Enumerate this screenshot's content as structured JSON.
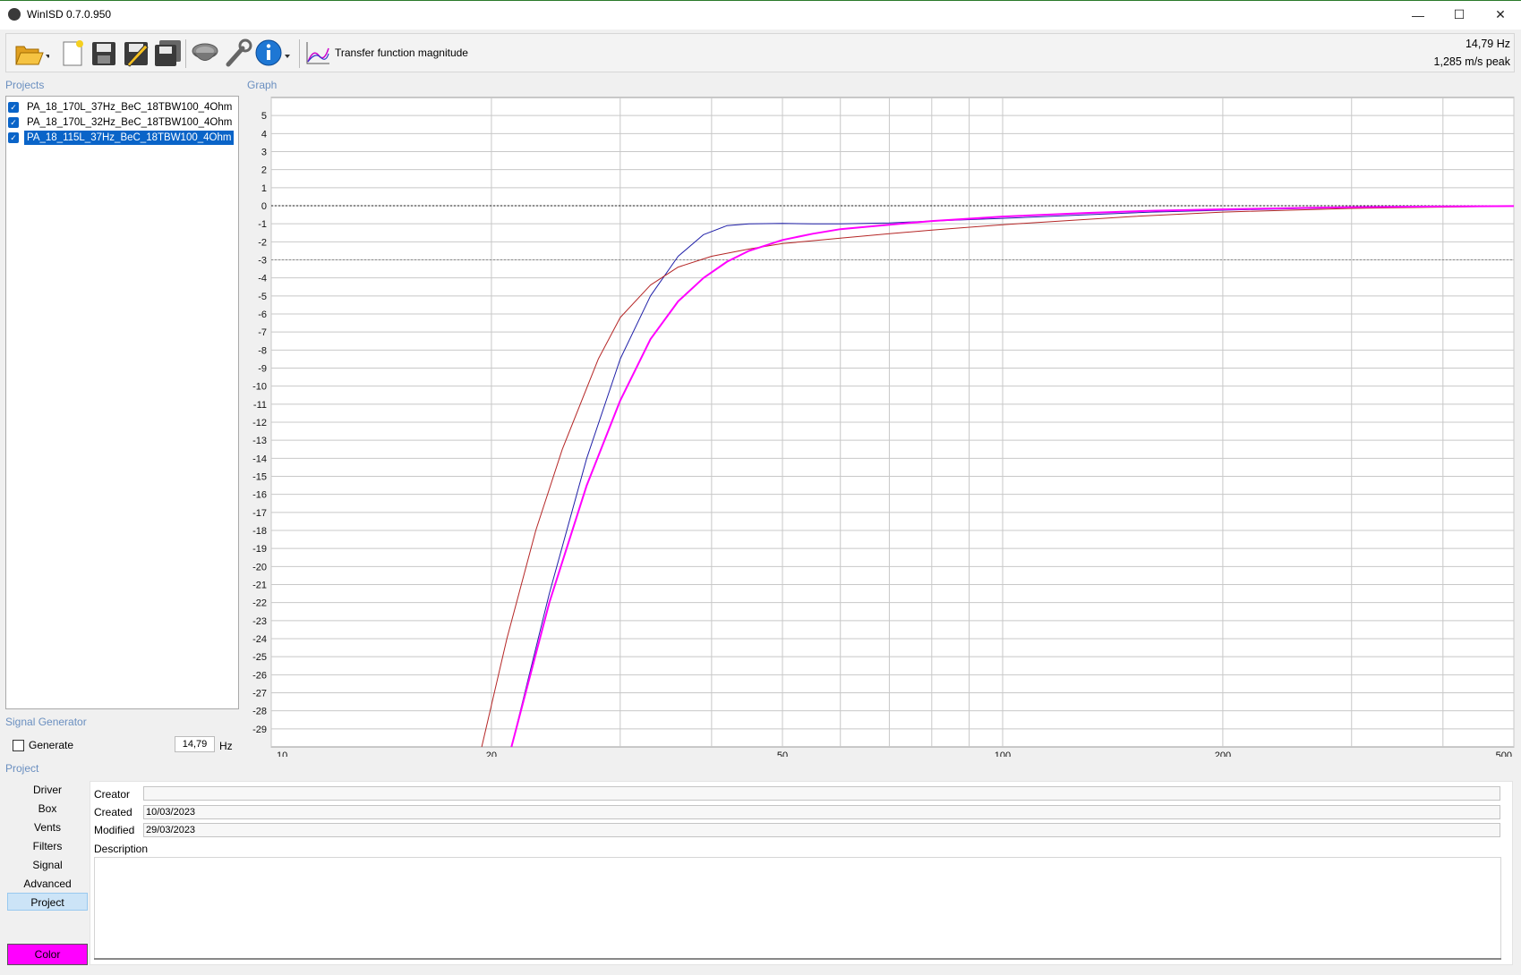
{
  "window": {
    "title": "WinISD 0.7.0.950",
    "minimize": "—",
    "maximize": "☐",
    "close": "✕"
  },
  "toolbar": {
    "tools": [
      "open-icon",
      "new-project-icon",
      "save-icon",
      "save-as-icon",
      "save-all-icon",
      "driver-icon",
      "tools-icon",
      "info-icon"
    ],
    "graph_selector_label": "Transfer function magnitude"
  },
  "status": {
    "frequency": "14,79 Hz",
    "excursion": "1,285 m/s peak"
  },
  "projects": {
    "title": "Projects",
    "items": [
      {
        "label": "PA_18_170L_37Hz_BeC_18TBW100_4Ohm",
        "checked": true,
        "selected": false
      },
      {
        "label": "PA_18_170L_32Hz_BeC_18TBW100_4Ohm",
        "checked": true,
        "selected": false
      },
      {
        "label": "PA_18_115L_37Hz_BeC_18TBW100_4Ohm",
        "checked": true,
        "selected": true
      }
    ]
  },
  "graph": {
    "title": "Graph"
  },
  "signal_generator": {
    "title": "Signal Generator",
    "generate_label": "Generate",
    "generate_checked": false,
    "frequency_value": "14,79",
    "unit": "Hz"
  },
  "project_panel": {
    "title": "Project",
    "nav": [
      "Driver",
      "Box",
      "Vents",
      "Filters",
      "Signal",
      "Advanced",
      "Project"
    ],
    "active_nav": "Project",
    "color_button": "Color",
    "fields": {
      "creator_label": "Creator",
      "creator_value": "",
      "created_label": "Created",
      "created_value": "10/03/2023",
      "modified_label": "Modified",
      "modified_value": "29/03/2023",
      "description_label": "Description",
      "description_value": ""
    }
  },
  "chart_data": {
    "type": "line",
    "x_scale": "log",
    "xlim": [
      10,
      500
    ],
    "ylim": [
      -30,
      6
    ],
    "x_ticks": [
      10,
      20,
      50,
      100,
      200,
      500
    ],
    "y_ticks": [
      5,
      4,
      3,
      2,
      1,
      0,
      -1,
      -2,
      -3,
      -4,
      -5,
      -6,
      -7,
      -8,
      -9,
      -10,
      -11,
      -12,
      -13,
      -14,
      -15,
      -16,
      -17,
      -18,
      -19,
      -20,
      -21,
      -22,
      -23,
      -24,
      -25,
      -26,
      -27,
      -28,
      -29
    ],
    "reference_lines": [
      0,
      -3
    ],
    "grid": true,
    "series": [
      {
        "name": "PA_18_170L_37Hz_BeC_18TBW100_4Ohm",
        "color": "#1f1fa8",
        "x": [
          21.3,
          24,
          27,
          30,
          33,
          36,
          39,
          42,
          45,
          50,
          55,
          60,
          70,
          80,
          100,
          130,
          160,
          200,
          260,
          300,
          400
        ],
        "y": [
          -30,
          -21.5,
          -14,
          -8.5,
          -5,
          -2.8,
          -1.6,
          -1.1,
          -1.0,
          -0.98,
          -1.0,
          -1.0,
          -0.95,
          -0.85,
          -0.7,
          -0.5,
          -0.35,
          -0.25,
          -0.15,
          -0.1,
          -0.05
        ]
      },
      {
        "name": "PA_18_170L_32Hz_BeC_18TBW100_4Ohm",
        "color": "#b52626",
        "x": [
          19.4,
          21,
          23,
          25,
          28,
          30,
          33,
          36,
          40,
          45,
          50,
          60,
          70,
          80,
          100,
          150,
          200,
          300,
          500
        ],
        "y": [
          -30,
          -24,
          -18,
          -13.5,
          -8.5,
          -6.2,
          -4.4,
          -3.4,
          -2.8,
          -2.4,
          -2.1,
          -1.8,
          -1.55,
          -1.35,
          -1.05,
          -0.6,
          -0.35,
          -0.15,
          -0.02
        ]
      },
      {
        "name": "PA_18_115L_37Hz_BeC_18TBW100_4Ohm",
        "color": "#ff00ff",
        "x": [
          21.3,
          24,
          27,
          30,
          33,
          36,
          39,
          42,
          45,
          50,
          55,
          60,
          70,
          80,
          100,
          130,
          160,
          200,
          260,
          300,
          400,
          500
        ],
        "y": [
          -30,
          -22,
          -15.5,
          -10.8,
          -7.4,
          -5.3,
          -4,
          -3.1,
          -2.5,
          -1.9,
          -1.55,
          -1.3,
          -1.05,
          -0.85,
          -0.6,
          -0.4,
          -0.28,
          -0.2,
          -0.12,
          -0.08,
          -0.04,
          -0.02
        ]
      }
    ]
  }
}
